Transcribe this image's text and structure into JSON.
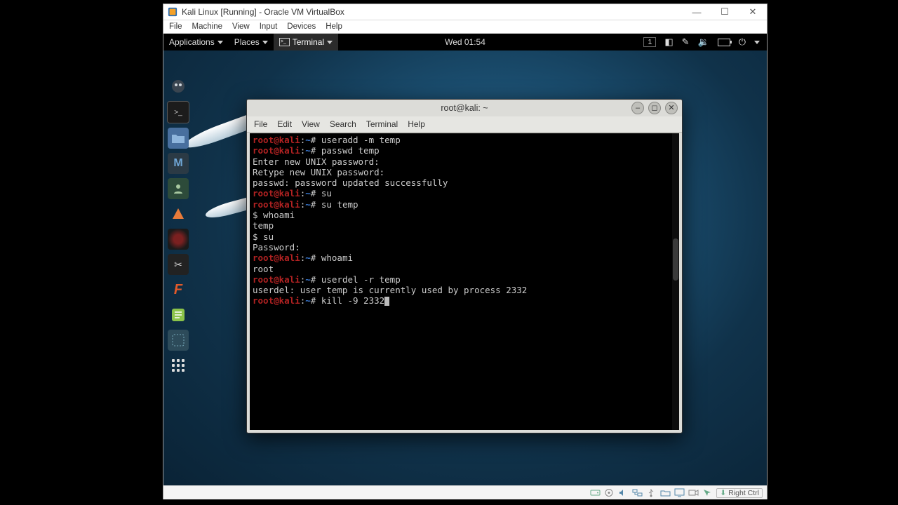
{
  "host": {
    "window_title": "Kali Linux [Running] - Oracle VM VirtualBox",
    "menu": [
      "File",
      "Machine",
      "View",
      "Input",
      "Devices",
      "Help"
    ],
    "status_hostkey": "Right Ctrl",
    "win_controls": {
      "min": "—",
      "max": "☐",
      "close": "✕"
    }
  },
  "gnome": {
    "applications": "Applications",
    "places": "Places",
    "active_app": "Terminal",
    "clock": "Wed 01:54",
    "workspace": "1",
    "tray": {
      "prefs": "prefs-icon",
      "rec": "record-icon",
      "vol": "volume-icon",
      "bat": "battery-icon",
      "pwr": "power-icon"
    }
  },
  "dock": {
    "items": [
      {
        "name": "app-root",
        "bg": "#2f3840"
      },
      {
        "name": "terminal",
        "bg": "#1c1c1c"
      },
      {
        "name": "files",
        "bg": "#486f9e"
      },
      {
        "name": "metasploit",
        "bg": "#2b3a45"
      },
      {
        "name": "app-user",
        "bg": "#2d4b3a"
      },
      {
        "name": "burp",
        "bg": "#c85a2a"
      },
      {
        "name": "armitage",
        "bg": "#222"
      },
      {
        "name": "tools",
        "bg": "#222"
      },
      {
        "name": "app-f",
        "bg": "#c85a2a"
      },
      {
        "name": "notes",
        "bg": "#7aa83c"
      },
      {
        "name": "tweaks",
        "bg": "#2d4b5a"
      },
      {
        "name": "show-apps",
        "bg": "transparent"
      }
    ]
  },
  "terminal": {
    "title": "root@kali: ~",
    "menu": [
      "File",
      "Edit",
      "View",
      "Search",
      "Terminal",
      "Help"
    ],
    "prompt_user": "root@kali",
    "prompt_path": "~",
    "lines": [
      {
        "t": "prompt",
        "cmd": "useradd -m temp"
      },
      {
        "t": "prompt",
        "cmd": "passwd temp"
      },
      {
        "t": "out",
        "txt": "Enter new UNIX password: "
      },
      {
        "t": "out",
        "txt": "Retype new UNIX password: "
      },
      {
        "t": "out",
        "txt": "passwd: password updated successfully"
      },
      {
        "t": "prompt",
        "cmd": "su"
      },
      {
        "t": "prompt",
        "cmd": "su temp"
      },
      {
        "t": "out",
        "txt": "$ whoami"
      },
      {
        "t": "out",
        "txt": "temp"
      },
      {
        "t": "out",
        "txt": "$ su"
      },
      {
        "t": "out",
        "txt": "Password: "
      },
      {
        "t": "prompt",
        "cmd": "whoami"
      },
      {
        "t": "out",
        "txt": "root"
      },
      {
        "t": "prompt",
        "cmd": "userdel -r temp"
      },
      {
        "t": "out",
        "txt": "userdel: user temp is currently used by process 2332"
      },
      {
        "t": "prompt",
        "cmd": "kill -9 2332",
        "cursor": true
      }
    ],
    "controls": {
      "min": "–",
      "max": "◻",
      "close": "✕"
    }
  }
}
